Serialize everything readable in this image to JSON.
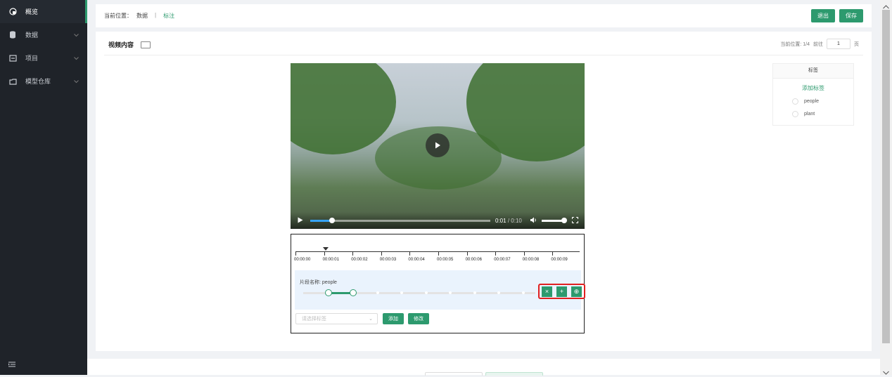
{
  "sidebar": {
    "items": [
      {
        "label": "概览",
        "icon": "dashboard-icon",
        "active": true
      },
      {
        "label": "数据",
        "icon": "database-icon",
        "expandable": true
      },
      {
        "label": "项目",
        "icon": "project-icon",
        "expandable": true
      },
      {
        "label": "模型仓库",
        "icon": "folder-icon",
        "expandable": true
      }
    ],
    "collapse_icon": "menu-collapse-icon"
  },
  "header": {
    "breadcrumb_prefix": "当前位置：",
    "breadcrumb": [
      "数据",
      "标注"
    ],
    "separator": "|",
    "exit_label": "退出",
    "save_label": "保存"
  },
  "panel": {
    "title": "视频内容",
    "pager_position": "当前位置: 1/4",
    "pager_goto": "前往",
    "pager_page": "1",
    "pager_unit": "页"
  },
  "video": {
    "time_current": "0:01",
    "time_sep": "/",
    "time_total": "0:10",
    "progress": 0.12,
    "volume": 1.0
  },
  "timeline": {
    "ticks": [
      "00:00:00",
      "00:00:01",
      "00:00:02",
      "00:00:03",
      "00:00:04",
      "00:00:05",
      "00:00:06",
      "00:00:07",
      "00:00:08",
      "00:00:09"
    ],
    "cursor_time": "00:00:01",
    "segment_label": "片段名称: people",
    "select_placeholder": "请选择标签",
    "add_label": "添加",
    "modify_label": "修改",
    "seg_buttons": [
      "×",
      "+",
      "⊕"
    ]
  },
  "tags": {
    "header": "标签",
    "add_label": "添加标签",
    "items": [
      "people",
      "plant"
    ]
  },
  "colors": {
    "accent": "#2d9a6e",
    "sidebar_bg": "#1f2329",
    "highlight": "#e02020",
    "progress": "#36a3f7"
  }
}
